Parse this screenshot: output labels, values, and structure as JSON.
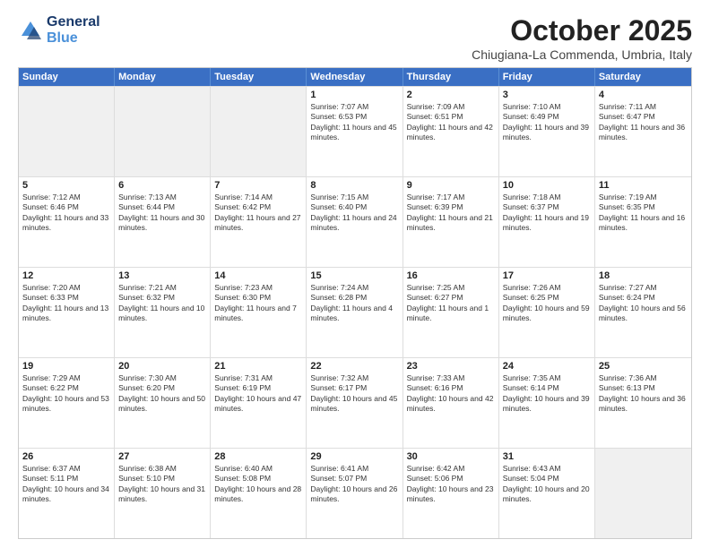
{
  "header": {
    "logo_line1": "General",
    "logo_line2": "Blue",
    "month_title": "October 2025",
    "location": "Chiugiana-La Commenda, Umbria, Italy"
  },
  "days_of_week": [
    "Sunday",
    "Monday",
    "Tuesday",
    "Wednesday",
    "Thursday",
    "Friday",
    "Saturday"
  ],
  "weeks": [
    [
      {
        "day": "",
        "info": ""
      },
      {
        "day": "",
        "info": ""
      },
      {
        "day": "",
        "info": ""
      },
      {
        "day": "1",
        "info": "Sunrise: 7:07 AM\nSunset: 6:53 PM\nDaylight: 11 hours and 45 minutes."
      },
      {
        "day": "2",
        "info": "Sunrise: 7:09 AM\nSunset: 6:51 PM\nDaylight: 11 hours and 42 minutes."
      },
      {
        "day": "3",
        "info": "Sunrise: 7:10 AM\nSunset: 6:49 PM\nDaylight: 11 hours and 39 minutes."
      },
      {
        "day": "4",
        "info": "Sunrise: 7:11 AM\nSunset: 6:47 PM\nDaylight: 11 hours and 36 minutes."
      }
    ],
    [
      {
        "day": "5",
        "info": "Sunrise: 7:12 AM\nSunset: 6:46 PM\nDaylight: 11 hours and 33 minutes."
      },
      {
        "day": "6",
        "info": "Sunrise: 7:13 AM\nSunset: 6:44 PM\nDaylight: 11 hours and 30 minutes."
      },
      {
        "day": "7",
        "info": "Sunrise: 7:14 AM\nSunset: 6:42 PM\nDaylight: 11 hours and 27 minutes."
      },
      {
        "day": "8",
        "info": "Sunrise: 7:15 AM\nSunset: 6:40 PM\nDaylight: 11 hours and 24 minutes."
      },
      {
        "day": "9",
        "info": "Sunrise: 7:17 AM\nSunset: 6:39 PM\nDaylight: 11 hours and 21 minutes."
      },
      {
        "day": "10",
        "info": "Sunrise: 7:18 AM\nSunset: 6:37 PM\nDaylight: 11 hours and 19 minutes."
      },
      {
        "day": "11",
        "info": "Sunrise: 7:19 AM\nSunset: 6:35 PM\nDaylight: 11 hours and 16 minutes."
      }
    ],
    [
      {
        "day": "12",
        "info": "Sunrise: 7:20 AM\nSunset: 6:33 PM\nDaylight: 11 hours and 13 minutes."
      },
      {
        "day": "13",
        "info": "Sunrise: 7:21 AM\nSunset: 6:32 PM\nDaylight: 11 hours and 10 minutes."
      },
      {
        "day": "14",
        "info": "Sunrise: 7:23 AM\nSunset: 6:30 PM\nDaylight: 11 hours and 7 minutes."
      },
      {
        "day": "15",
        "info": "Sunrise: 7:24 AM\nSunset: 6:28 PM\nDaylight: 11 hours and 4 minutes."
      },
      {
        "day": "16",
        "info": "Sunrise: 7:25 AM\nSunset: 6:27 PM\nDaylight: 11 hours and 1 minute."
      },
      {
        "day": "17",
        "info": "Sunrise: 7:26 AM\nSunset: 6:25 PM\nDaylight: 10 hours and 59 minutes."
      },
      {
        "day": "18",
        "info": "Sunrise: 7:27 AM\nSunset: 6:24 PM\nDaylight: 10 hours and 56 minutes."
      }
    ],
    [
      {
        "day": "19",
        "info": "Sunrise: 7:29 AM\nSunset: 6:22 PM\nDaylight: 10 hours and 53 minutes."
      },
      {
        "day": "20",
        "info": "Sunrise: 7:30 AM\nSunset: 6:20 PM\nDaylight: 10 hours and 50 minutes."
      },
      {
        "day": "21",
        "info": "Sunrise: 7:31 AM\nSunset: 6:19 PM\nDaylight: 10 hours and 47 minutes."
      },
      {
        "day": "22",
        "info": "Sunrise: 7:32 AM\nSunset: 6:17 PM\nDaylight: 10 hours and 45 minutes."
      },
      {
        "day": "23",
        "info": "Sunrise: 7:33 AM\nSunset: 6:16 PM\nDaylight: 10 hours and 42 minutes."
      },
      {
        "day": "24",
        "info": "Sunrise: 7:35 AM\nSunset: 6:14 PM\nDaylight: 10 hours and 39 minutes."
      },
      {
        "day": "25",
        "info": "Sunrise: 7:36 AM\nSunset: 6:13 PM\nDaylight: 10 hours and 36 minutes."
      }
    ],
    [
      {
        "day": "26",
        "info": "Sunrise: 6:37 AM\nSunset: 5:11 PM\nDaylight: 10 hours and 34 minutes."
      },
      {
        "day": "27",
        "info": "Sunrise: 6:38 AM\nSunset: 5:10 PM\nDaylight: 10 hours and 31 minutes."
      },
      {
        "day": "28",
        "info": "Sunrise: 6:40 AM\nSunset: 5:08 PM\nDaylight: 10 hours and 28 minutes."
      },
      {
        "day": "29",
        "info": "Sunrise: 6:41 AM\nSunset: 5:07 PM\nDaylight: 10 hours and 26 minutes."
      },
      {
        "day": "30",
        "info": "Sunrise: 6:42 AM\nSunset: 5:06 PM\nDaylight: 10 hours and 23 minutes."
      },
      {
        "day": "31",
        "info": "Sunrise: 6:43 AM\nSunset: 5:04 PM\nDaylight: 10 hours and 20 minutes."
      },
      {
        "day": "",
        "info": ""
      }
    ]
  ]
}
